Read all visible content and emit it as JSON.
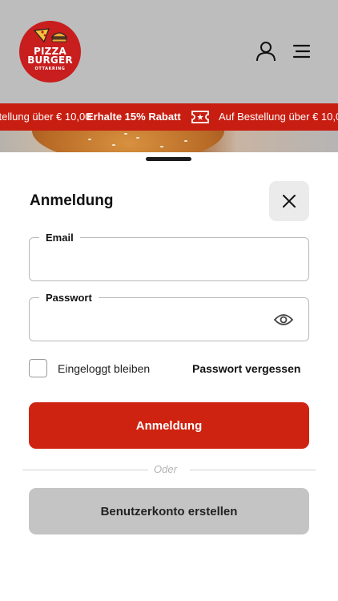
{
  "header": {
    "logo": {
      "line1": "PIZZA",
      "line2": "BURGER",
      "line3": "OTTAKRING"
    },
    "icons": {
      "account": "user-icon",
      "menu": "hamburger-menu-icon"
    }
  },
  "promo": {
    "text_left": "stellung über € 10,00",
    "text_bold": "Erhalte 15% Rabatt",
    "text_right": "Auf Bestellung über € 10,00",
    "icon": "coupon-ticket-icon"
  },
  "login": {
    "title": "Anmeldung",
    "email": {
      "label": "Email",
      "value": "",
      "placeholder": ""
    },
    "password": {
      "label": "Passwort",
      "value": "",
      "placeholder": ""
    },
    "remember_label": "Eingeloggt bleiben",
    "forgot_label": "Passwort vergessen",
    "submit_label": "Anmeldung",
    "or_label": "Oder",
    "register_label": "Benutzerkonto erstellen"
  },
  "colors": {
    "brand_red": "#cf2311",
    "header_bg": "#bdbdbd",
    "secondary_button": "#c4c4c4"
  }
}
